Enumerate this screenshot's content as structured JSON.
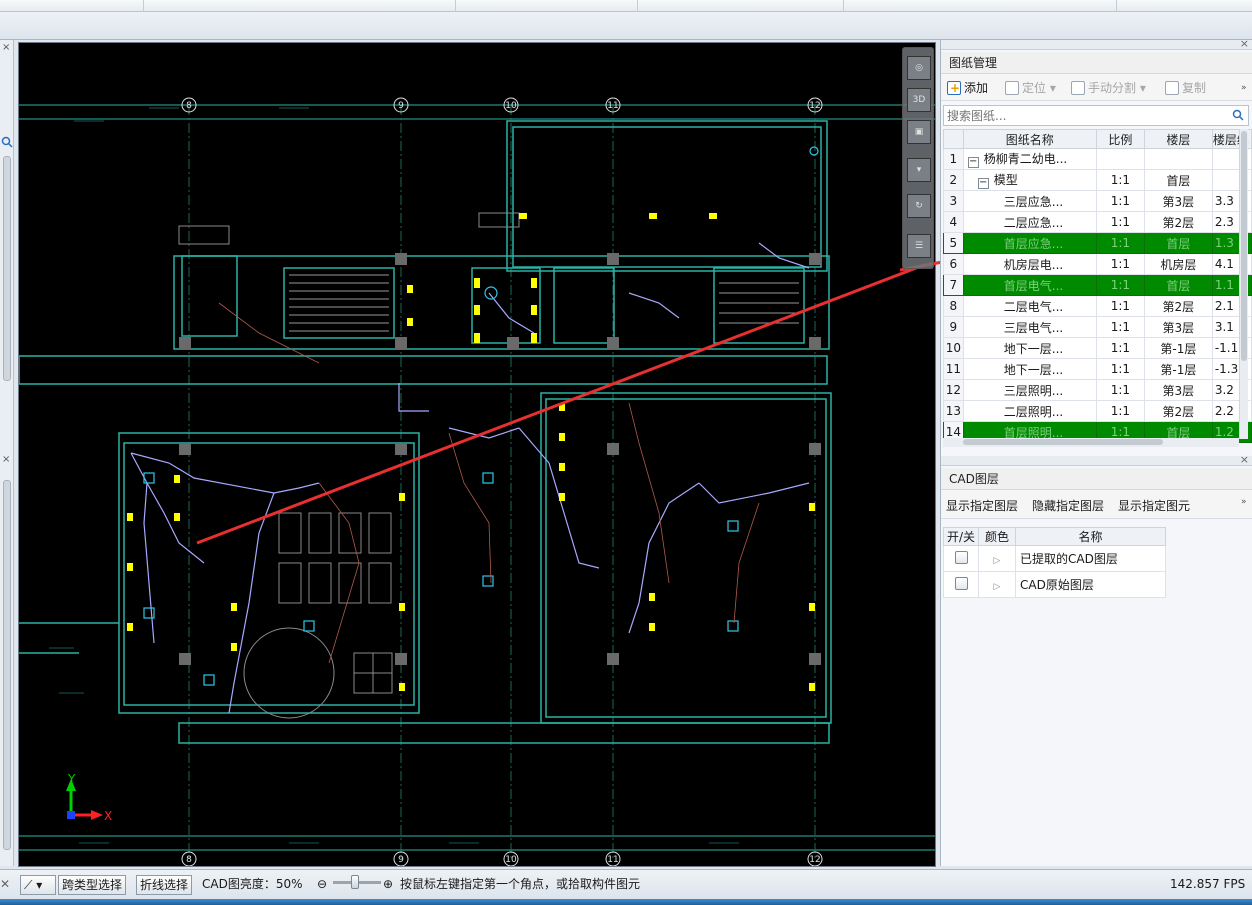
{
  "statusbar": {
    "btn_cross_type": "跨类型选择",
    "btn_polyline": "折线选择",
    "brightness_label": "CAD图亮度：50%",
    "brightness_value": 50,
    "hint": "按鼠标左键指定第一个角点，或拾取构件图元",
    "fps": "142.857 FPS"
  },
  "drawing_manager": {
    "title": "图纸管理",
    "toolbar": {
      "add": "添加",
      "locate": "定位",
      "manual_split": "手动分割",
      "copy": "复制"
    },
    "search_placeholder": "搜索图纸...",
    "columns": [
      "图纸名称",
      "比例",
      "楼层",
      "楼层编"
    ],
    "rows": [
      {
        "n": "1",
        "name": "杨柳青二幼电...",
        "scale": "",
        "floor": "",
        "code": "",
        "toggle": "−"
      },
      {
        "n": "2",
        "name": "模型",
        "scale": "1:1",
        "floor": "首层",
        "code": "",
        "toggle": "−"
      },
      {
        "n": "3",
        "name": "三层应急...",
        "scale": "1:1",
        "floor": "第3层",
        "code": "3.3"
      },
      {
        "n": "4",
        "name": "二层应急...",
        "scale": "1:1",
        "floor": "第2层",
        "code": "2.3"
      },
      {
        "n": "5",
        "name": "首层应急...",
        "scale": "1:1",
        "floor": "首层",
        "code": "1.3",
        "selected": true
      },
      {
        "n": "6",
        "name": "机房层电...",
        "scale": "1:1",
        "floor": "机房层",
        "code": "4.1"
      },
      {
        "n": "7",
        "name": "首层电气...",
        "scale": "1:1",
        "floor": "首层",
        "code": "1.1",
        "selected": true
      },
      {
        "n": "8",
        "name": "二层电气...",
        "scale": "1:1",
        "floor": "第2层",
        "code": "2.1"
      },
      {
        "n": "9",
        "name": "三层电气...",
        "scale": "1:1",
        "floor": "第3层",
        "code": "3.1"
      },
      {
        "n": "10",
        "name": "地下一层...",
        "scale": "1:1",
        "floor": "第-1层",
        "code": "-1.1"
      },
      {
        "n": "11",
        "name": "地下一层...",
        "scale": "1:1",
        "floor": "第-1层",
        "code": "-1.3"
      },
      {
        "n": "12",
        "name": "三层照明...",
        "scale": "1:1",
        "floor": "第3层",
        "code": "3.2"
      },
      {
        "n": "13",
        "name": "二层照明...",
        "scale": "1:1",
        "floor": "第2层",
        "code": "2.2"
      },
      {
        "n": "14",
        "name": "首层照明...",
        "scale": "1:1",
        "floor": "首层",
        "code": "1.2",
        "selected": true
      }
    ]
  },
  "cad_layers": {
    "title": "CAD图层",
    "buttons": [
      "显示指定图层",
      "隐藏指定图层",
      "显示指定图元"
    ],
    "columns": [
      "开/关",
      "颜色",
      "名称"
    ],
    "rows": [
      {
        "name": "已提取的CAD图层"
      },
      {
        "name": "CAD原始图层"
      }
    ]
  },
  "drawing": {
    "grid_top_labels": [
      "8",
      "9",
      "10",
      "11",
      "12"
    ],
    "grid_bottom_labels": [
      "8",
      "9",
      "10",
      "11",
      "12"
    ],
    "axis_x_label": "X",
    "axis_y_label": "Y",
    "colors": {
      "background": "#000000",
      "wall": "#2ab3a6",
      "wire": "#a8a8ff",
      "fixture": "#ffff00",
      "annotation_arrow": "#e83030",
      "selected_row": "#008a00"
    }
  }
}
